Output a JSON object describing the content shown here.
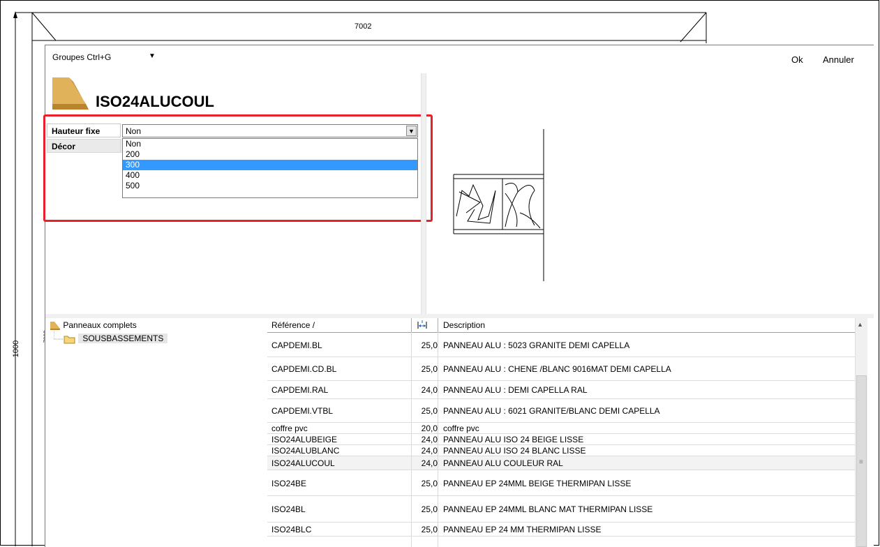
{
  "background": {
    "dim_top": "7002",
    "dim_left": "1000",
    "dim_left_small": "7002"
  },
  "toolbar": {
    "groups_label": "Groupes  Ctrl+G",
    "ok_label": "Ok",
    "cancel_label": "Annuler"
  },
  "product": {
    "title": "ISO24ALUCOUL"
  },
  "properties": {
    "height_label": "Hauteur fixe",
    "height_value": "Non",
    "decor_label": "Décor",
    "dropdown_options": [
      "Non",
      "200",
      "300",
      "400",
      "500"
    ],
    "dropdown_selected": "300"
  },
  "tree": {
    "root": "Panneaux complets",
    "child": "SOUSBASSEMENTS"
  },
  "table": {
    "headers": {
      "reference": "Référence /",
      "thickness_icon": "thickness-icon",
      "description": "Description"
    },
    "rows": [
      {
        "ref": "CAPDEMI.BL",
        "ep": "25,0",
        "desc": "PANNEAU ALU : 5023 GRANITE DEMI CAPELLA"
      },
      {
        "ref": "CAPDEMI.CD.BL",
        "ep": "25,0",
        "desc": "PANNEAU ALU : CHENE /BLANC 9016MAT DEMI CAPELLA"
      },
      {
        "ref": "CAPDEMI.RAL",
        "ep": "24,0",
        "desc": "PANNEAU ALU :  DEMI CAPELLA RAL"
      },
      {
        "ref": "CAPDEMI.VTBL",
        "ep": "25,0",
        "desc": "PANNEAU ALU : 6021 GRANITE/BLANC DEMI CAPELLA"
      },
      {
        "ref": "coffre pvc",
        "ep": "20,0",
        "desc": "coffre pvc"
      },
      {
        "ref": "ISO24ALUBEIGE",
        "ep": "24,0",
        "desc": "PANNEAU ALU ISO 24 BEIGE LISSE"
      },
      {
        "ref": "ISO24ALUBLANC",
        "ep": "24,0",
        "desc": "PANNEAU ALU ISO 24 BLANC LISSE"
      },
      {
        "ref": "ISO24ALUCOUL",
        "ep": "24,0",
        "desc": "PANNEAU ALU COULEUR RAL"
      },
      {
        "ref": "ISO24BE",
        "ep": "25,0",
        "desc": "PANNEAU EP 24MML BEIGE THERMIPAN LISSE"
      },
      {
        "ref": "ISO24BL",
        "ep": "25,0",
        "desc": "PANNEAU EP 24MML BLANC MAT THERMIPAN LISSE"
      },
      {
        "ref": "ISO24BLC",
        "ep": "25,0",
        "desc": "PANNEAU EP 24 MM THERMIPAN LISSE"
      }
    ],
    "selected_ref": "ISO24ALUCOUL"
  },
  "colors": {
    "highlight": "#e8202a",
    "selection": "#3399ff",
    "icon_gold": "#d9a441"
  }
}
